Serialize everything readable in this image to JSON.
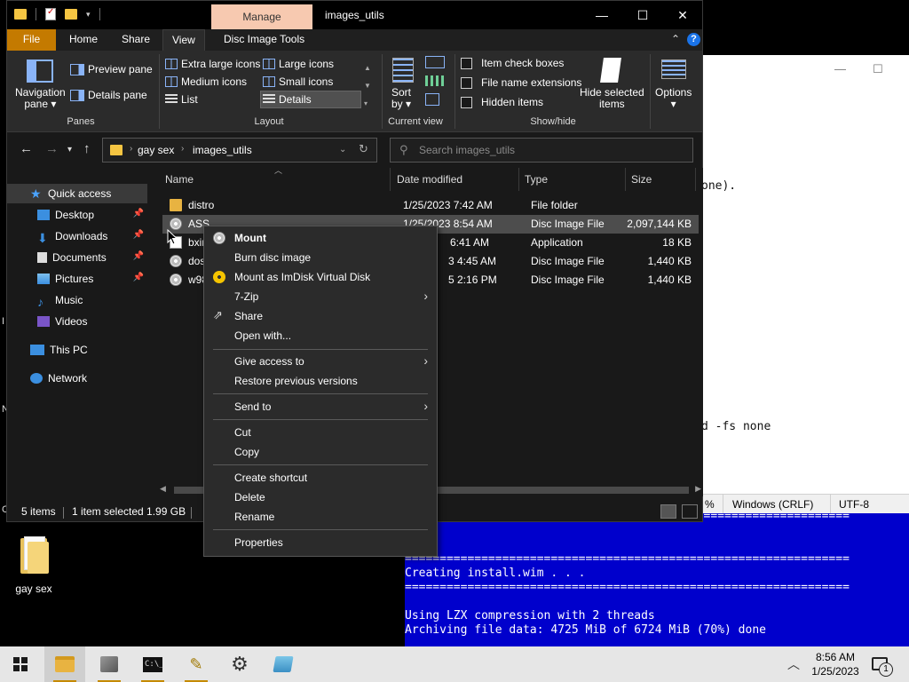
{
  "explorer": {
    "title": "images_utils",
    "manage_label": "Manage",
    "window_controls": {
      "minimize": "—",
      "maximize": "☐",
      "close": "✕"
    },
    "tabs": {
      "file": "File",
      "home": "Home",
      "share": "Share",
      "view": "View",
      "disc_tools": "Disc Image Tools"
    },
    "ribbon": {
      "navigation_pane": "Navigation",
      "navigation_pane_2": "pane ▾",
      "preview_pane": "Preview pane",
      "details_pane": "Details pane",
      "panes_label": "Panes",
      "layout_items": {
        "extra_large": "Extra large icons",
        "large": "Large icons",
        "medium": "Medium icons",
        "small": "Small icons",
        "list": "List",
        "details": "Details"
      },
      "layout_label": "Layout",
      "sort_by_1": "Sort",
      "sort_by_2": "by ▾",
      "current_view_label": "Current view",
      "item_check_boxes": "Item check boxes",
      "file_name_extensions": "File name extensions",
      "hidden_items": "Hidden items",
      "hide_selected_1": "Hide selected",
      "hide_selected_2": "items",
      "show_hide_label": "Show/hide",
      "options": "Options"
    },
    "address": {
      "crumbs": [
        "gay sex",
        "images_utils"
      ],
      "search_placeholder": "Search images_utils"
    },
    "nav_pane": {
      "quick_access": "Quick access",
      "items": [
        {
          "label": "Desktop",
          "pinned": true
        },
        {
          "label": "Downloads",
          "pinned": true
        },
        {
          "label": "Documents",
          "pinned": true
        },
        {
          "label": "Pictures",
          "pinned": true
        },
        {
          "label": "Music",
          "pinned": false
        },
        {
          "label": "Videos",
          "pinned": false
        }
      ],
      "this_pc": "This PC",
      "network": "Network"
    },
    "columns": {
      "name": "Name",
      "date": "Date modified",
      "type": "Type",
      "size": "Size"
    },
    "files": [
      {
        "name": "distro",
        "date": "1/25/2023 7:42 AM",
        "type": "File folder",
        "size": "",
        "icon": "folder-icon"
      },
      {
        "name": "ASS",
        "date": "1/25/2023 8:54 AM",
        "type": "Disc Image File",
        "size": "2,097,144 KB",
        "icon": "disc-image-icon"
      },
      {
        "name": "bxim",
        "date": "6:41 AM",
        "type": "Application",
        "size": "18 KB",
        "icon": "application-icon"
      },
      {
        "name": "dos6",
        "date": "3 4:45 AM",
        "type": "Disc Image File",
        "size": "1,440 KB",
        "icon": "disc-image-icon"
      },
      {
        "name": "w98",
        "date": "5 2:16 PM",
        "type": "Disc Image File",
        "size": "1,440 KB",
        "icon": "disc-image-icon"
      }
    ],
    "status": {
      "count": "5 items",
      "selected": "1 item selected  1.99 GB"
    }
  },
  "context_menu": {
    "mount": "Mount",
    "burn": "Burn disc image",
    "imdisk": "Mount as ImDisk Virtual Disk",
    "zip": "7-Zip",
    "share": "Share",
    "open_with": "Open with...",
    "give_access": "Give access to",
    "restore": "Restore previous versions",
    "send_to": "Send to",
    "cut": "Cut",
    "copy": "Copy",
    "create_shortcut": "Create shortcut",
    "delete": "Delete",
    "rename": "Rename",
    "properties": "Properties"
  },
  "notepad": {
    "line1": "one).",
    "line2": "d -fs none",
    "status_pct": "%",
    "status_eol": "Windows (CRLF)",
    "status_enc": "UTF-8"
  },
  "console": {
    "rule": "================================================================",
    "line1": "Creating install.wim . . .",
    "line2": "Using LZX compression with 2 threads",
    "line3": "Archiving file data: 4725 MiB of 6724 MiB (70%) done"
  },
  "desktop": {
    "icon_label": "gay sex",
    "side_i": "I",
    "side_n": "N",
    "side_c": "C"
  },
  "taskbar": {
    "time": "8:56 AM",
    "date": "1/25/2023",
    "notif_count": "1",
    "cmd_glyph": "C:\\_"
  },
  "colors": {
    "accent_file_tab": "#c47a00",
    "manage_tab": "#f7c9b0",
    "console_bg": "#0000cc"
  }
}
